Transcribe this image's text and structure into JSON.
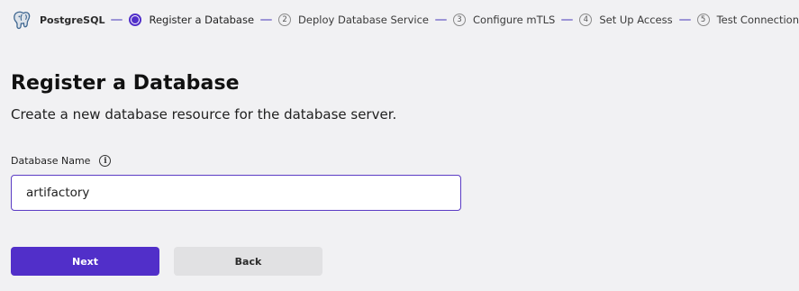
{
  "header": {
    "product_name": "PostgreSQL",
    "logo_icon": "postgresql-elephant-icon",
    "steps": [
      {
        "number": "",
        "label": "Register a Database",
        "active": true
      },
      {
        "number": "2",
        "label": "Deploy Database Service",
        "active": false
      },
      {
        "number": "3",
        "label": "Configure mTLS",
        "active": false
      },
      {
        "number": "4",
        "label": "Set Up Access",
        "active": false
      },
      {
        "number": "5",
        "label": "Test Connection",
        "active": false
      }
    ]
  },
  "form": {
    "title": "Register a Database",
    "subtitle": "Create a new database resource for the database server.",
    "database_name_label": "Database Name",
    "info_icon_glyph": "i",
    "database_name_value": "artifactory"
  },
  "buttons": {
    "next_label": "Next",
    "back_label": "Back"
  },
  "colors": {
    "accent": "#512fc9",
    "background": "#f1f1f3",
    "secondary_button": "#e1e1e3"
  }
}
